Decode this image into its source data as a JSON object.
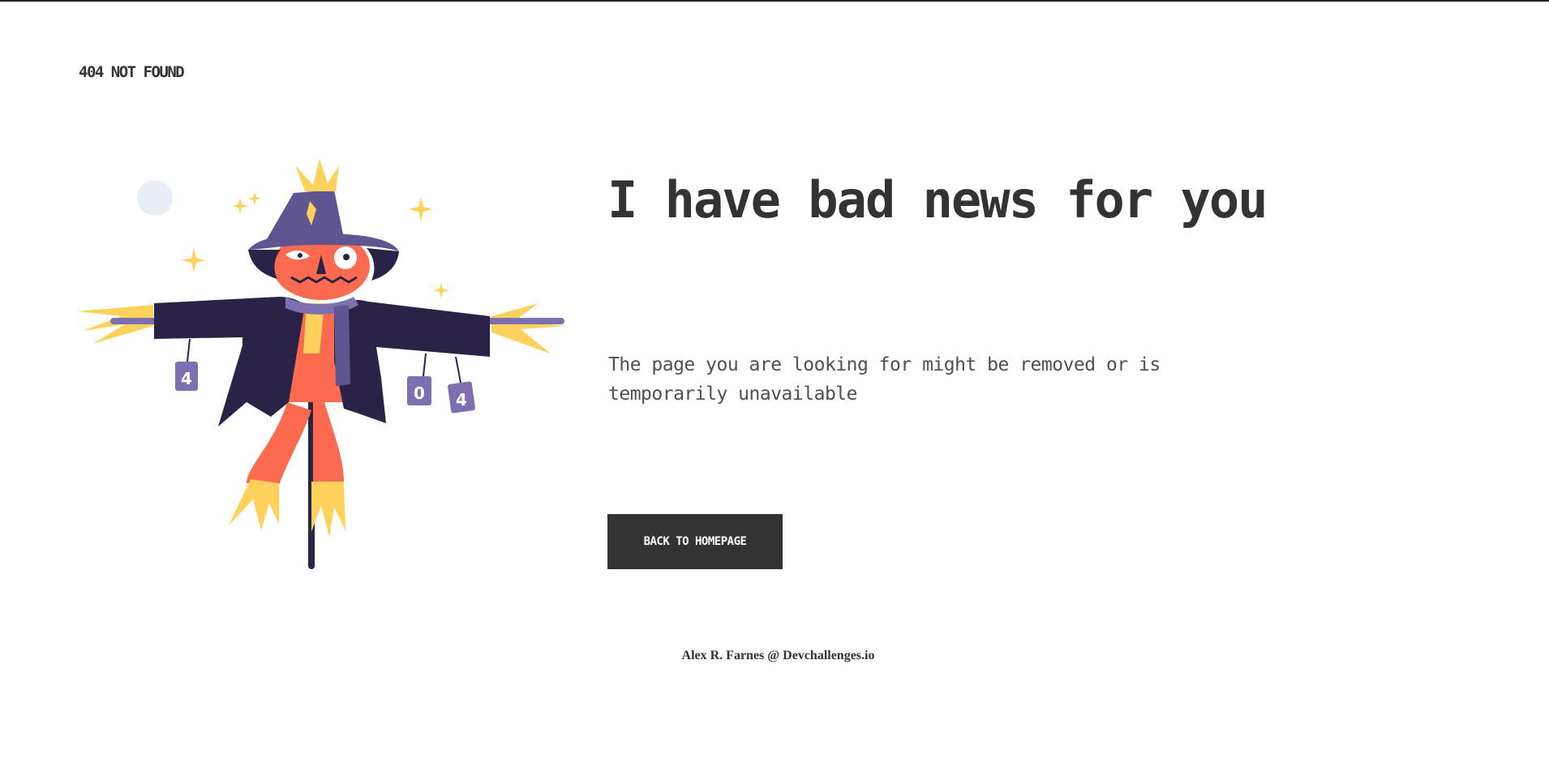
{
  "header": {
    "brand": "404 NOT FOUND"
  },
  "illustration": {
    "subject": "scarecrow",
    "can_labels": [
      "4",
      "0",
      "4"
    ]
  },
  "main": {
    "headline": "I have bad news for you",
    "message": "The page you are looking for might be removed or is temporarily unavailable",
    "button_label": "BACK TO HOMEPAGE"
  },
  "footer": {
    "credit": "Alex R. Farnes @ Devchallenges.io"
  },
  "colors": {
    "text": "#333333",
    "button_bg": "#333333",
    "button_text": "#ffffff",
    "coat": "#2b2347",
    "hat": "#5f5591",
    "face": "#fc6a4f",
    "straw": "#fdd25c",
    "moon": "#e9edf5"
  }
}
